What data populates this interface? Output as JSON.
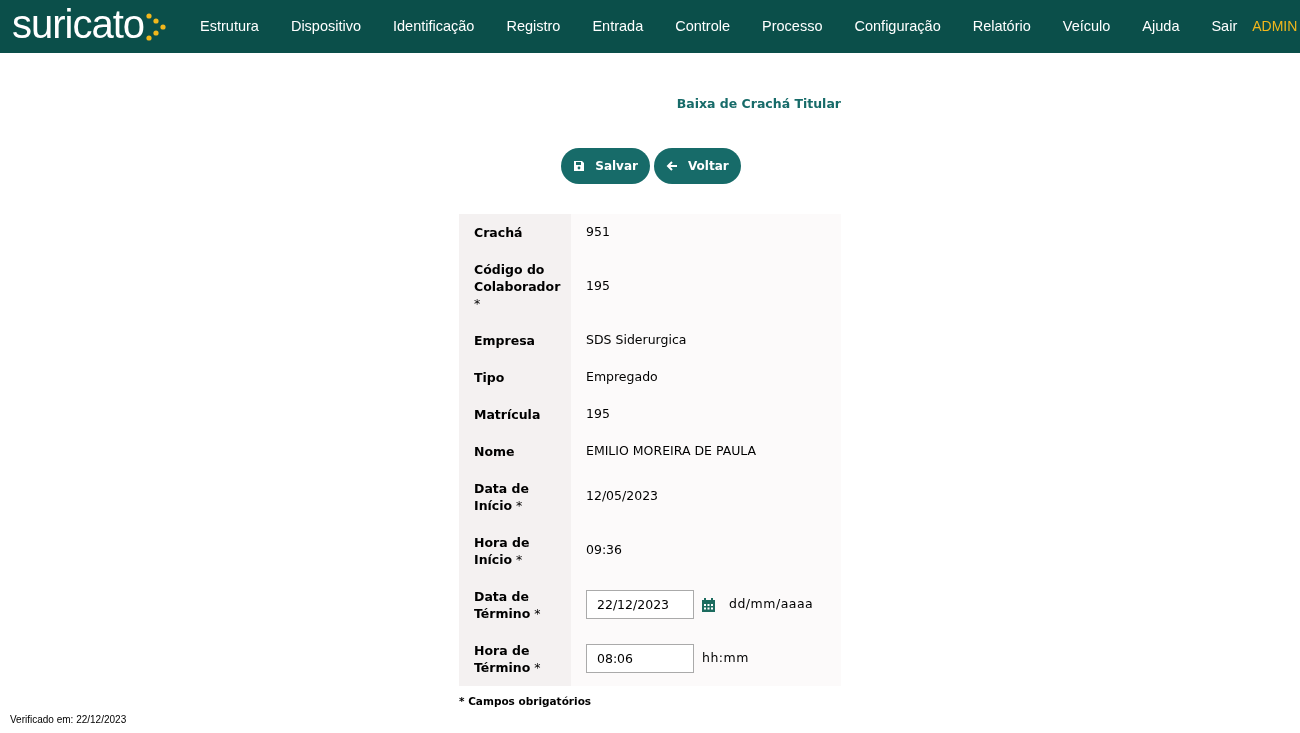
{
  "brand": {
    "name": "suricato"
  },
  "nav": [
    "Estrutura",
    "Dispositivo",
    "Identificação",
    "Registro",
    "Entrada",
    "Controle",
    "Processo",
    "Configuração",
    "Relatório",
    "Veículo",
    "Ajuda",
    "Sair"
  ],
  "user": "ADMIN",
  "title": "Baixa de Crachá Titular",
  "buttons": [
    {
      "kind": "save",
      "label": "Salvar"
    },
    {
      "kind": "back",
      "label": "Voltar"
    }
  ],
  "rows": [
    {
      "kind": "text",
      "label": "**Crachá**",
      "value": "951"
    },
    {
      "kind": "text",
      "label": "**Código do Colaborador** *",
      "value": "195"
    },
    {
      "kind": "text",
      "label": "**Empresa**",
      "value": "SDS Siderurgica"
    },
    {
      "kind": "text",
      "label": "**Tipo**",
      "value": "Empregado"
    },
    {
      "kind": "text",
      "label": "**Matrícula**",
      "value": "195"
    },
    {
      "kind": "text",
      "label": "**Nome**",
      "value": "EMILIO MOREIRA DE PAULA"
    },
    {
      "kind": "text",
      "label": "**Data de Início** *",
      "value": "12/05/2023"
    },
    {
      "kind": "text",
      "label": "**Hora de Início** *",
      "value": "09:36"
    },
    {
      "kind": "date",
      "label": "**Data de Término** *",
      "value": "22/12/2023",
      "hint": "dd/mm/aaaa"
    },
    {
      "kind": "time",
      "label": "**Hora de Término** *",
      "value": "08:06",
      "hint": "hh:mm"
    }
  ],
  "footnote": "* Campos obrigatórios",
  "verified": "Verificado em: 22/12/2023"
}
